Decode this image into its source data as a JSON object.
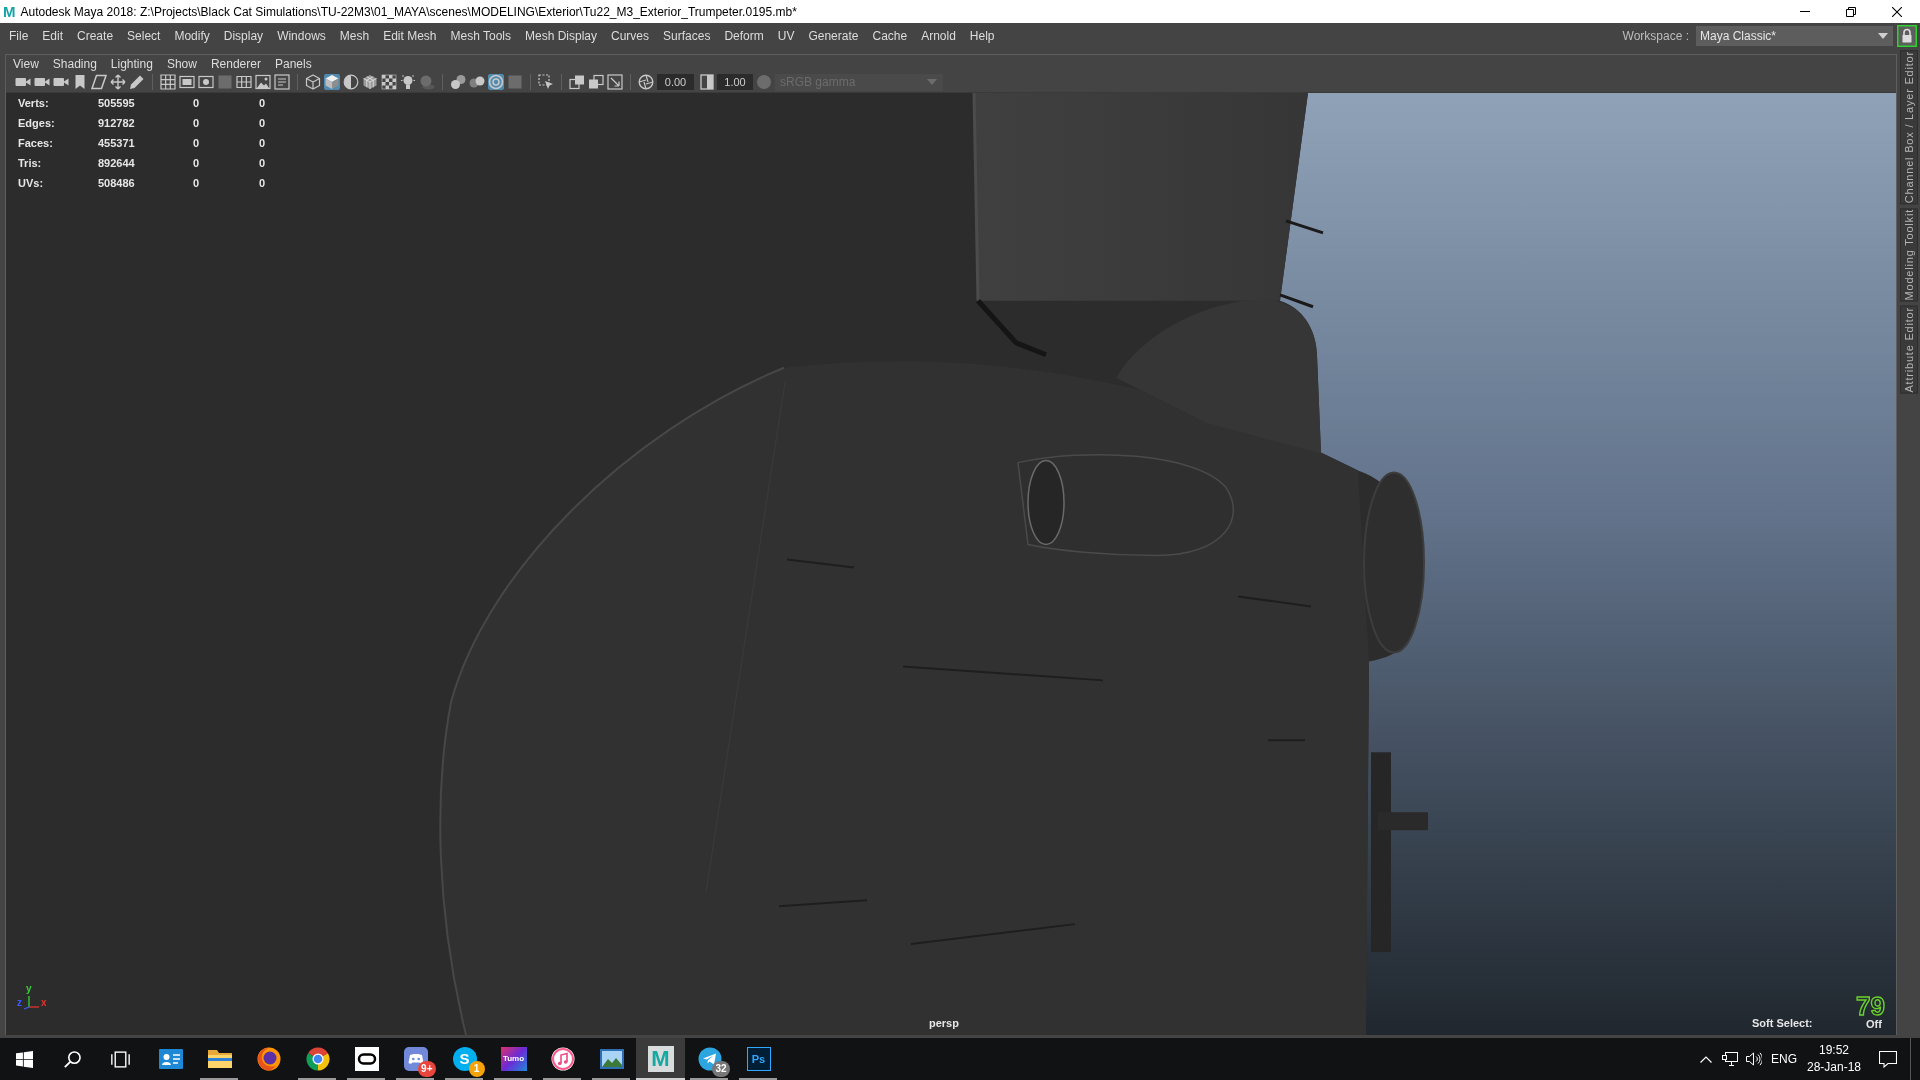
{
  "window": {
    "app_icon": "M",
    "title": "Autodesk Maya 2018: Z:\\Projects\\Black Cat Simulations\\TU-22M3\\01_MAYA\\scenes\\MODELING\\Exterior\\Tu22_M3_Exterior_Trumpeter.0195.mb*"
  },
  "menu_bar": {
    "items": [
      "File",
      "Edit",
      "Create",
      "Select",
      "Modify",
      "Display",
      "Windows",
      "Mesh",
      "Edit Mesh",
      "Mesh Tools",
      "Mesh Display",
      "Curves",
      "Surfaces",
      "Deform",
      "UV",
      "Generate",
      "Cache",
      "Arnold",
      "Help"
    ],
    "workspace": {
      "label": "Workspace :",
      "value": "Maya Classic*"
    },
    "lock": {
      "highlighted": true
    }
  },
  "panel": {
    "menu": [
      "View",
      "Shading",
      "Lighting",
      "Show",
      "Renderer",
      "Panels"
    ],
    "toolbar": {
      "groups": [
        [
          {
            "kind": "camera",
            "on": false,
            "disabled": false
          },
          {
            "kind": "camera",
            "on": false,
            "disabled": false
          },
          {
            "kind": "camera",
            "on": false,
            "disabled": false
          },
          {
            "kind": "bookmark",
            "on": false,
            "disabled": false
          },
          {
            "kind": "plane",
            "on": false,
            "disabled": false
          },
          {
            "kind": "move",
            "on": false,
            "disabled": false
          },
          {
            "kind": "pencil",
            "on": false,
            "disabled": false
          }
        ],
        [
          {
            "kind": "grid",
            "on": false,
            "disabled": false
          },
          {
            "kind": "frame",
            "on": false,
            "disabled": false
          },
          {
            "kind": "framedot",
            "on": false,
            "disabled": false
          },
          {
            "kind": "square",
            "on": false,
            "disabled": true
          },
          {
            "kind": "framegrid",
            "on": false,
            "disabled": false
          },
          {
            "kind": "picture",
            "on": false,
            "disabled": false
          },
          {
            "kind": "textframe",
            "on": false,
            "disabled": false
          }
        ],
        [
          {
            "kind": "wirecube",
            "on": false,
            "disabled": false
          },
          {
            "kind": "solidcube",
            "on": true,
            "disabled": false
          },
          {
            "kind": "halfsphere",
            "on": false,
            "disabled": false
          },
          {
            "kind": "gridcube",
            "on": false,
            "disabled": false
          },
          {
            "kind": "checker",
            "on": false,
            "disabled": false
          },
          {
            "kind": "bulb",
            "on": false,
            "disabled": false
          },
          {
            "kind": "shadowsphere",
            "on": false,
            "disabled": true
          }
        ],
        [
          {
            "kind": "spheres",
            "on": false,
            "disabled": false
          },
          {
            "kind": "blurspheres",
            "on": false,
            "disabled": false
          },
          {
            "kind": "target",
            "on": true,
            "disabled": false
          },
          {
            "kind": "square",
            "on": false,
            "disabled": true
          }
        ],
        [
          {
            "kind": "selectbox",
            "on": false,
            "disabled": false
          }
        ],
        [
          {
            "kind": "windows",
            "on": false,
            "disabled": false
          },
          {
            "kind": "windowsalt",
            "on": false,
            "disabled": false
          },
          {
            "kind": "framearrow",
            "on": false,
            "disabled": false
          }
        ]
      ],
      "exposure": "0.00",
      "gamma": "1.00",
      "color_space": {
        "value": "sRGB gamma",
        "disabled": true
      }
    },
    "viewport": {
      "hud": [
        {
          "label": "Verts:",
          "values": [
            "505595",
            "0",
            "0"
          ]
        },
        {
          "label": "Edges:",
          "values": [
            "912782",
            "0",
            "0"
          ]
        },
        {
          "label": "Faces:",
          "values": [
            "455371",
            "0",
            "0"
          ]
        },
        {
          "label": "Tris:",
          "values": [
            "892644",
            "0",
            "0"
          ]
        },
        {
          "label": "UVs:",
          "values": [
            "508486",
            "0",
            "0"
          ]
        }
      ],
      "axes": [
        {
          "kind": "vertical",
          "label": "y",
          "color": "#35d135"
        },
        {
          "kind": "depth",
          "label": "z",
          "color": "#3d5cff"
        },
        {
          "kind": "horizontal",
          "label": "x",
          "color": "#e4322b"
        }
      ],
      "camera": "persp",
      "soft_select": {
        "label": "Soft Select:",
        "value": "Off"
      },
      "fps_overlay": "79"
    }
  },
  "side_tabs": [
    "Channel Box / Layer Editor",
    "Modeling Toolkit",
    "Attribute Editor"
  ],
  "taskbar": {
    "system": [
      {
        "kind": "start"
      },
      {
        "kind": "search"
      },
      {
        "kind": "taskview"
      }
    ],
    "apps": [
      {
        "kind": "contactcard",
        "running": false,
        "active": false
      },
      {
        "kind": "folder",
        "running": true,
        "active": false
      },
      {
        "kind": "globe",
        "running": false,
        "active": false
      },
      {
        "kind": "segmented",
        "running": true,
        "active": false
      },
      {
        "kind": "visor",
        "running": true,
        "active": false
      },
      {
        "kind": "gamepad",
        "running": true,
        "active": false,
        "badge": {
          "text": "9+",
          "color": "#e8453c"
        }
      },
      {
        "kind": "chat",
        "logo_text": "S",
        "running": true,
        "active": false,
        "badge": {
          "text": "1",
          "color": "#f4a30b"
        }
      },
      {
        "kind": "poster",
        "logo_text": "Tumo",
        "running": true,
        "active": false
      },
      {
        "kind": "music",
        "running": true,
        "active": false
      },
      {
        "kind": "landscape",
        "running": true,
        "active": false
      },
      {
        "kind": "modeler",
        "logo_text": "M",
        "running": true,
        "active": true
      },
      {
        "kind": "paperplane",
        "running": true,
        "active": false,
        "badge": {
          "text": "32",
          "color": "#777777"
        }
      },
      {
        "kind": "imageeditor",
        "logo_text": "Ps",
        "running": true,
        "active": false
      }
    ],
    "tray": {
      "language": "ENG",
      "time": "19:52",
      "date": "28-Jan-18"
    }
  }
}
